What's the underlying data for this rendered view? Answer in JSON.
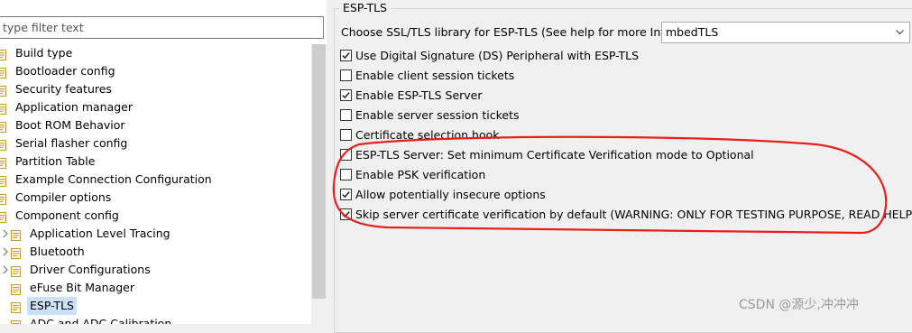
{
  "sidebar": {
    "filter_placeholder": "type filter text",
    "items": [
      {
        "label": "Build type",
        "level": 0
      },
      {
        "label": "Bootloader config",
        "level": 0
      },
      {
        "label": "Security features",
        "level": 0
      },
      {
        "label": "Application manager",
        "level": 0
      },
      {
        "label": "Boot ROM Behavior",
        "level": 0
      },
      {
        "label": "Serial flasher config",
        "level": 0
      },
      {
        "label": "Partition Table",
        "level": 0
      },
      {
        "label": "Example Connection Configuration",
        "level": 0
      },
      {
        "label": "Compiler options",
        "level": 0
      },
      {
        "label": "Component config",
        "level": 0
      },
      {
        "label": "Application Level Tracing",
        "level": 1,
        "expandable": true
      },
      {
        "label": "Bluetooth",
        "level": 1,
        "expandable": true
      },
      {
        "label": "Driver Configurations",
        "level": 1,
        "expandable": true
      },
      {
        "label": "eFuse Bit Manager",
        "level": 1
      },
      {
        "label": "ESP-TLS",
        "level": 1,
        "selected": true
      },
      {
        "label": "ADC and ADC Calibration",
        "level": 1
      }
    ]
  },
  "panel": {
    "group_title": "ESP-TLS",
    "library_label": "Choose SSL/TLS library for ESP-TLS (See help for more Info)",
    "library_value": "mbedTLS",
    "options": [
      {
        "label": "Use Digital Signature (DS) Peripheral with ESP-TLS",
        "checked": true
      },
      {
        "label": "Enable client session tickets",
        "checked": false
      },
      {
        "label": "Enable ESP-TLS Server",
        "checked": true
      },
      {
        "label": "Enable server session tickets",
        "checked": false
      },
      {
        "label": "Certificate selection hook",
        "checked": false
      },
      {
        "label": "ESP-TLS Server: Set minimum Certificate Verification mode to Optional",
        "checked": false
      },
      {
        "label": "Enable PSK verification",
        "checked": false
      },
      {
        "label": "Allow potentially insecure options",
        "checked": true
      },
      {
        "label": "Skip server certificate verification by default (WARNING: ONLY FOR TESTING PURPOSE, READ HELP)",
        "checked": true
      }
    ]
  },
  "watermark": "CSDN @源少,冲冲冲",
  "colors": {
    "selection": "#cce0f7",
    "annotation": "#e8201a",
    "background": "#f0f0f0"
  }
}
